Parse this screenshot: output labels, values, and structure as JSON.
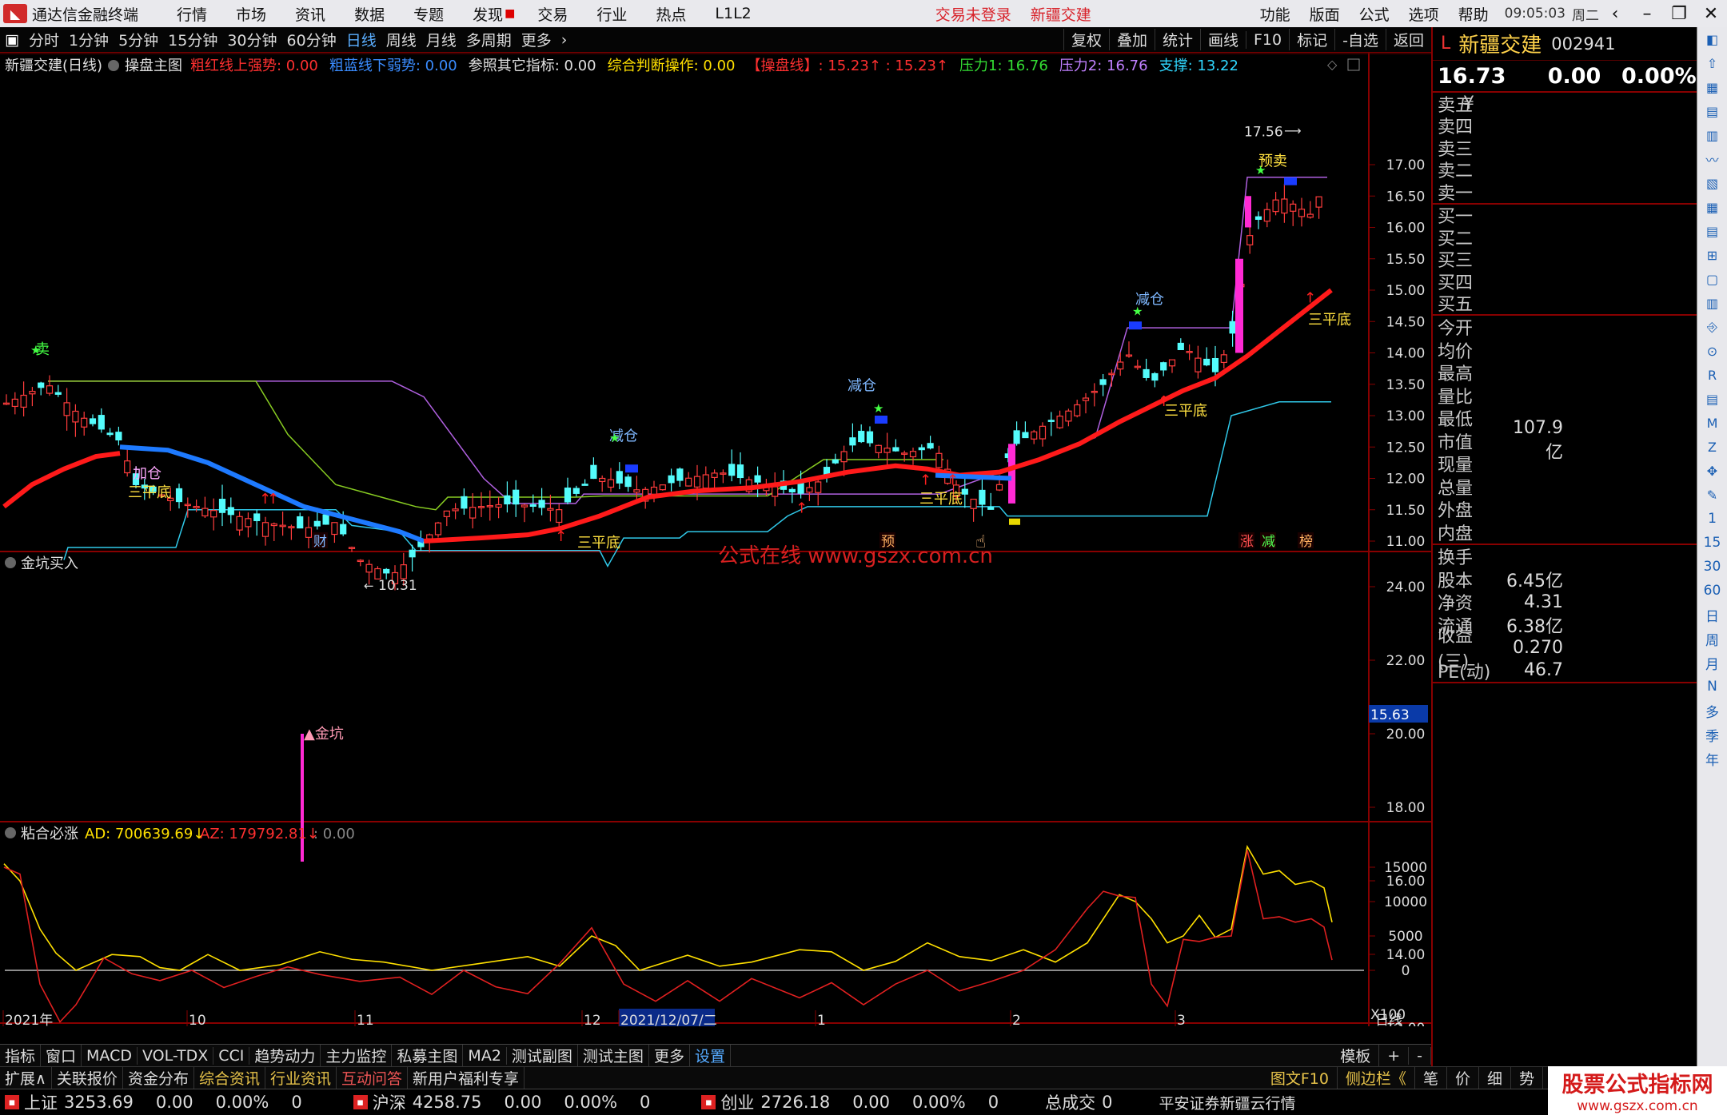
{
  "titlebar": {
    "app_title": "通达信金融终端",
    "menus": [
      "行情",
      "市场",
      "资讯",
      "数据",
      "专题",
      "发现",
      "交易",
      "行业",
      "热点",
      "L1L2"
    ],
    "status_login": "交易未登录",
    "status_stock": "新疆交建",
    "right_menus": [
      "功能",
      "版面",
      "公式",
      "选项",
      "帮助"
    ],
    "time": "09:05:03",
    "weekday": "周二"
  },
  "periodbar": {
    "periods": [
      "分时",
      "1分钟",
      "5分钟",
      "15分钟",
      "30分钟",
      "60分钟",
      "日线",
      "周线",
      "月线",
      "多周期",
      "更多"
    ],
    "active": "日线",
    "right_buttons": [
      "复权",
      "叠加",
      "统计",
      "画线",
      "F10",
      "标记",
      "-自选",
      "返回"
    ]
  },
  "main_header": {
    "title": "新疆交建(日线)",
    "indicator": "操盘主图",
    "items": [
      {
        "label": "粗红线上强势: 0.00",
        "color": "#ff3030"
      },
      {
        "label": "粗蓝线下弱势: 0.00",
        "color": "#3a8cff"
      },
      {
        "label": "参照其它指标: 0.00",
        "color": "#e0e0e0"
      },
      {
        "label": "综合判断操作: 0.00",
        "color": "#ffe000"
      },
      {
        "label": "【操盘线】: 15.23↑ : 15.23↑",
        "color": "#ff3030"
      },
      {
        "label": "压力1: 16.76",
        "color": "#33dd33"
      },
      {
        "label": "压力2: 16.76",
        "color": "#c080ff"
      },
      {
        "label": "支撑: 13.22",
        "color": "#30d8ff"
      }
    ]
  },
  "price_axis": [
    "17.00",
    "16.50",
    "16.00",
    "15.50",
    "15.00",
    "14.50",
    "14.00",
    "13.50",
    "13.00",
    "12.50",
    "12.00",
    "11.50",
    "11.00"
  ],
  "annotations": {
    "high": "17.56",
    "low": "10.31",
    "signals": [
      {
        "t": "卖",
        "c": "#44ff44"
      },
      {
        "t": "加仓",
        "c": "#ffa8ff"
      },
      {
        "t": "三平底",
        "c": "#ffe040"
      },
      {
        "t": "减仓",
        "c": "#7fb8ff"
      },
      {
        "t": "三平底",
        "c": "#ffe040"
      },
      {
        "t": "减仓",
        "c": "#7fb8ff"
      },
      {
        "t": "三平底",
        "c": "#ffe040"
      },
      {
        "t": "三平底",
        "c": "#ffe040"
      },
      {
        "t": "减仓",
        "c": "#7fb8ff"
      },
      {
        "t": "三平底",
        "c": "#ffe040"
      },
      {
        "t": "预卖",
        "c": "#ffe040"
      }
    ],
    "events": [
      {
        "t": "财",
        "c": "#7fb8ff"
      },
      {
        "t": "预",
        "c": "#ffb060"
      },
      {
        "t": "涨",
        "c": "#ff5050"
      },
      {
        "t": "减",
        "c": "#50ff50"
      },
      {
        "t": "榜",
        "c": "#ffb060"
      }
    ]
  },
  "watermark": "公式在线  www.gszx.com.cn",
  "panel2": {
    "title": "金坑买入",
    "axis": [
      "24.00",
      "22.00",
      "20.00",
      "18.00",
      "16.00",
      "14.00",
      "12.00"
    ],
    "current": "15.63",
    "signal": "金坑"
  },
  "panel3": {
    "title": "粘合必涨",
    "ad": "AD: 700639.69↓",
    "az": "AZ: 179792.81↓",
    "other": ": 0.00",
    "axis": [
      "15000",
      "10000",
      "5000",
      "0"
    ],
    "scale": "X100"
  },
  "date_axis": {
    "labels": [
      "2021年",
      "10",
      "11",
      "12",
      "2021/12/07/二",
      "1",
      "2",
      "3"
    ],
    "period": "日线"
  },
  "bottom_tabs": [
    "指标",
    "窗口",
    "MACD",
    "VOL-TDX",
    "CCI",
    "趋势动力",
    "主力监控",
    "私募主图",
    "MA2",
    "测试副图",
    "测试主图",
    "更多",
    "设置"
  ],
  "bottom_right": [
    "模板",
    "+",
    "-"
  ],
  "bottom_tabs2": [
    "扩展∧",
    "关联报价",
    "资金分布",
    "综合资讯",
    "行业资讯",
    "互动问答",
    "新用户福利专享"
  ],
  "bottom_right2": [
    "图文F10",
    "侧边栏《",
    "笔",
    "价",
    "细",
    "势"
  ],
  "quote": {
    "name": "新疆交建",
    "code": "002941",
    "price": "16.73",
    "change": "0.00",
    "pct": "0.00%",
    "asks": [
      "卖五",
      "卖四",
      "卖三",
      "卖二",
      "卖一"
    ],
    "ask_suffix": "¥",
    "bids": [
      "买一",
      "买二",
      "买三",
      "买四",
      "买五"
    ],
    "fields": [
      [
        "今开",
        ""
      ],
      [
        "均价",
        ""
      ],
      [
        "最高",
        ""
      ],
      [
        "量比",
        ""
      ],
      [
        "最低",
        ""
      ],
      [
        "市值",
        "107.9亿"
      ],
      [
        "现量",
        ""
      ],
      [
        "总量",
        ""
      ],
      [
        "外盘",
        ""
      ],
      [
        "内盘",
        ""
      ]
    ],
    "fields2": [
      [
        "换手",
        ""
      ],
      [
        "股本",
        "6.45亿"
      ],
      [
        "净资",
        "4.31"
      ],
      [
        "流通",
        "6.38亿"
      ],
      [
        "收益(三)",
        "0.270"
      ],
      [
        "PE(动)",
        "46.7"
      ]
    ]
  },
  "statusbar": {
    "indices": [
      {
        "name": "上证",
        "value": "3253.69",
        "chg": "0.00",
        "pct": "0.00%",
        "vol": "0"
      },
      {
        "name": "沪深",
        "value": "4258.75",
        "chg": "0.00",
        "pct": "0.00%",
        "vol": "0"
      },
      {
        "name": "创业",
        "value": "2726.18",
        "chg": "0.00",
        "pct": "0.00%",
        "vol": "0"
      }
    ],
    "total_label": "总成交",
    "total": "0",
    "broker": "平安证券新疆云行情"
  },
  "brand": {
    "line1": "股票公式指标网",
    "line2": "www.gszx.com.cn"
  },
  "tools": [
    "R",
    "M",
    "Z",
    "1",
    "15",
    "30",
    "60",
    "日",
    "周",
    "月",
    "N",
    "多",
    "季",
    "年"
  ],
  "colors": {
    "up": "#ff3c3c",
    "down": "#54fcfc",
    "ma_red": "#ff1a1a",
    "ma_blue": "#1e7aff",
    "border": "#800000",
    "yellow": "#e8d800"
  }
}
